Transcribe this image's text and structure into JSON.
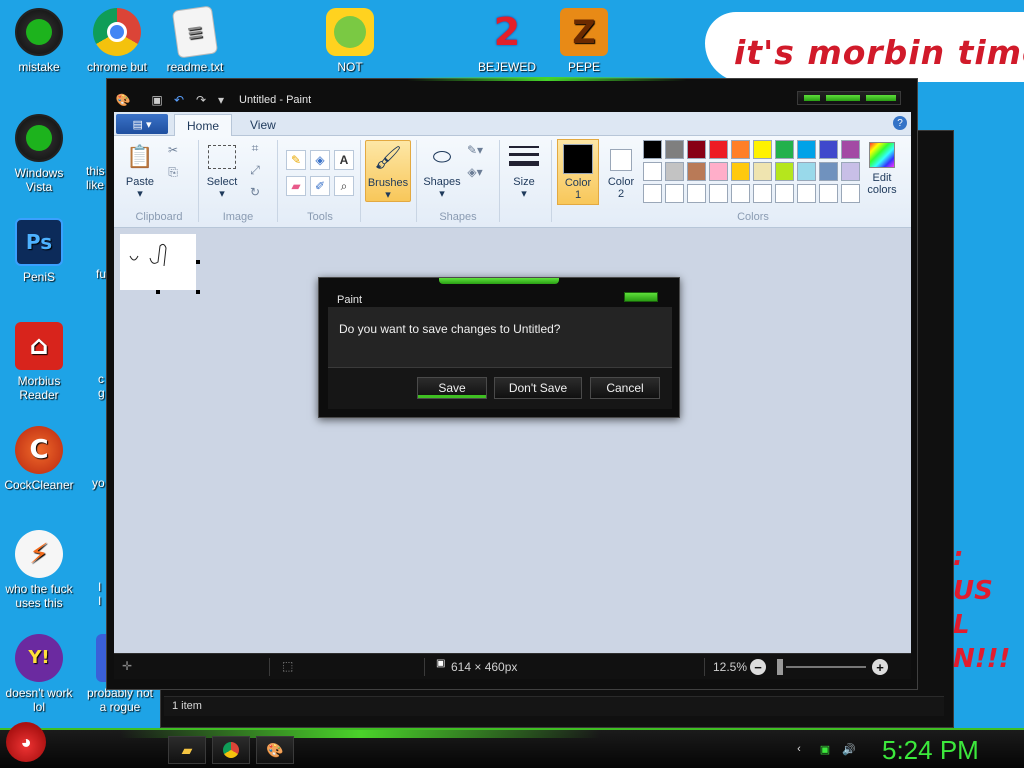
{
  "desktop": {
    "icons": [
      {
        "label": "mistake",
        "glyph": "",
        "color": "#1a1a1a"
      },
      {
        "label": "chrome but\nnor",
        "glyph": "",
        "color": "#ffffff"
      },
      {
        "label": "readme.txt",
        "glyph": "",
        "color": "#f4f4f4"
      },
      {
        "label": "NOT",
        "glyph": "",
        "color": "#ffd21f"
      },
      {
        "label": "BEJEWED",
        "glyph": "2",
        "color": "#e3202a"
      },
      {
        "label": "PEPE",
        "glyph": "Z",
        "color": "#e88a16"
      },
      {
        "label": "Windows\nVista",
        "glyph": "",
        "color": "#1a1a1a"
      },
      {
        "label": "PeniS",
        "glyph": "Ps",
        "color": "#0c2b5a"
      },
      {
        "label": "Morbius\nReader",
        "glyph": "",
        "color": "#d8241c"
      },
      {
        "label": "CockCleaner",
        "glyph": "C",
        "color": "#e04a1c"
      },
      {
        "label": "who the fuck\nuses this",
        "glyph": "",
        "color": "#f6f6f6"
      },
      {
        "label": "doesn't work\nlol",
        "glyph": "Y!",
        "color": "#6b2aa0"
      },
      {
        "label": "probably not\na rogue",
        "glyph": "",
        "color": "#3a5fd8"
      }
    ],
    "partial_labels": [
      "this\nlike",
      "fu",
      "c\ng",
      "yo",
      "I\nI"
    ],
    "speech_text": "it's morbin time",
    "right_scribble": ":\nUS\nL\nN!!!"
  },
  "taskbar": {
    "clock": "5:24 PM",
    "items": [
      "explorer",
      "chrome",
      "paint"
    ]
  },
  "background_window": {
    "status": "1 item"
  },
  "paint": {
    "title": "Untitled - Paint",
    "tabs": [
      "Home",
      "View"
    ],
    "active_tab": "Home",
    "groups": {
      "clipboard": {
        "label": "Clipboard",
        "paste": "Paste"
      },
      "image": {
        "label": "Image",
        "select": "Select"
      },
      "tools": {
        "label": "Tools"
      },
      "brushes": {
        "label": "Brushes"
      },
      "shapes": {
        "label": "Shapes",
        "shapes_btn": "Shapes"
      },
      "size": {
        "label": "Size"
      },
      "color1": {
        "label": "Color\n1",
        "value": "#000000"
      },
      "color2": {
        "label": "Color\n2",
        "value": "#ffffff"
      },
      "colors": {
        "label": "Colors"
      },
      "edit_colors": {
        "label": "Edit\ncolors"
      }
    },
    "palette": [
      "#000000",
      "#7f7f7f",
      "#880015",
      "#ed1c24",
      "#ff7f27",
      "#fff200",
      "#22b14c",
      "#00a2e8",
      "#3f48cc",
      "#a349a4",
      "#ffffff",
      "#c3c3c3",
      "#b97a57",
      "#ffaec9",
      "#ffc90e",
      "#efe4b0",
      "#b5e61d",
      "#99d9ea",
      "#7092be",
      "#c8bfe7",
      "#ffffff",
      "#ffffff",
      "#ffffff",
      "#ffffff",
      "#ffffff",
      "#ffffff",
      "#ffffff",
      "#ffffff",
      "#ffffff",
      "#ffffff"
    ],
    "status": {
      "dimensions": "614 × 460px",
      "zoom": "12.5%"
    }
  },
  "dialog": {
    "title": "Paint",
    "message": "Do you want to save changes to Untitled?",
    "buttons": {
      "save": "Save",
      "dont_save": "Don't Save",
      "cancel": "Cancel"
    }
  }
}
